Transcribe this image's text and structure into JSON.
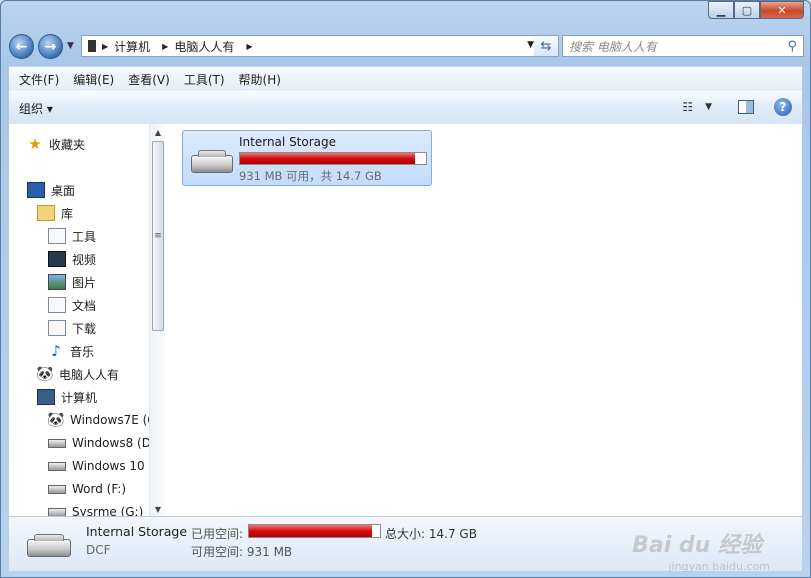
{
  "window": {
    "controls": {
      "minimize": "▁",
      "maximize": "▢",
      "close": "✕"
    }
  },
  "nav": {
    "back": "←",
    "forward": "→"
  },
  "address": {
    "segments": [
      "计算机",
      "电脑人人有"
    ]
  },
  "search": {
    "placeholder": "搜索 电脑人人有"
  },
  "menu": {
    "items": [
      "文件(F)",
      "编辑(E)",
      "查看(V)",
      "工具(T)",
      "帮助(H)"
    ]
  },
  "toolbar": {
    "organize": "组织 ▾"
  },
  "sidebar": {
    "favorites": "收藏夹",
    "desktop": "桌面",
    "libraries": "库",
    "items": [
      "工具",
      "视频",
      "图片",
      "文档",
      "下载",
      "音乐"
    ],
    "user": "电脑人人有",
    "computer": "计算机",
    "drives": [
      "Windows7E (C",
      "Windows8 (D",
      "Windows 10 (",
      "Word (F:)",
      "Sysrme (G:)"
    ]
  },
  "storage": {
    "name": "Internal Storage",
    "used_fraction": 0.94,
    "free_text": "931 MB 可用，共 14.7 GB"
  },
  "details": {
    "name": "Internal Storage",
    "type": "DCF",
    "used_label": "已用空间:",
    "total_label": "总大小: 14.7 GB",
    "free_label": "可用空间: 931 MB"
  },
  "watermark": {
    "main": "Bai du 经验",
    "url": "jingyan.baidu.com"
  },
  "colors": {
    "usage_bar": "#d10d0d",
    "selection": "#c1dcfb",
    "frame": "#a9c7e8"
  }
}
